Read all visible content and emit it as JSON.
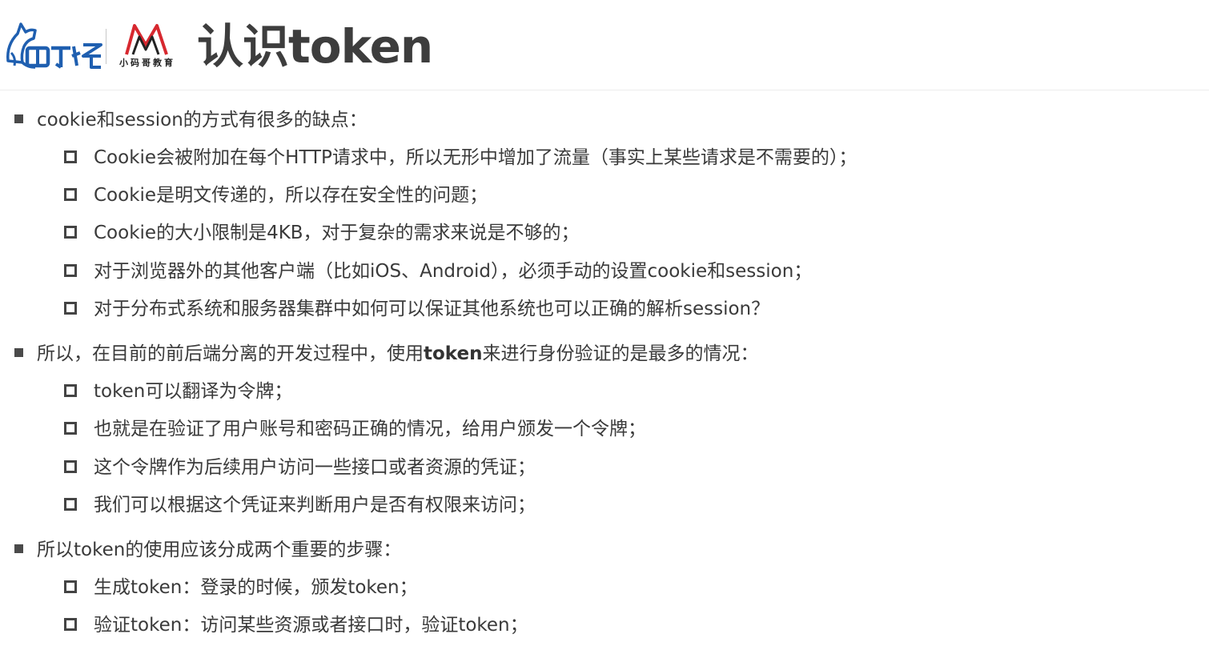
{
  "header": {
    "title": "认识token",
    "logo_wolf": "wolf-logo",
    "logo_xmg_text": "小码哥教育",
    "brand_colors": {
      "wolf_blue": "#1f5fb0",
      "xmg_red": "#d7282f",
      "xmg_dark": "#222222"
    }
  },
  "sections": [
    {
      "heading": "cookie和session的方式有很多的缺点：",
      "items": [
        "Cookie会被附加在每个HTTP请求中，所以无形中增加了流量（事实上某些请求是不需要的）；",
        "Cookie是明文传递的，所以存在安全性的问题；",
        "Cookie的大小限制是4KB，对于复杂的需求来说是不够的；",
        "对于浏览器外的其他客户端（比如iOS、Android），必须手动的设置cookie和session；",
        "对于分布式系统和服务器集群中如何可以保证其他系统也可以正确的解析session？"
      ]
    },
    {
      "heading_pre": "所以，在目前的前后端分离的开发过程中，使用",
      "heading_bold": "token",
      "heading_post": "来进行身份验证的是最多的情况：",
      "items": [
        "token可以翻译为令牌；",
        "也就是在验证了用户账号和密码正确的情况，给用户颁发一个令牌；",
        "这个令牌作为后续用户访问一些接口或者资源的凭证；",
        "我们可以根据这个凭证来判断用户是否有权限来访问；"
      ]
    },
    {
      "heading": "所以token的使用应该分成两个重要的步骤：",
      "items": [
        "生成token：登录的时候，颁发token；",
        "验证token：访问某些资源或者接口时，验证token；"
      ]
    }
  ]
}
